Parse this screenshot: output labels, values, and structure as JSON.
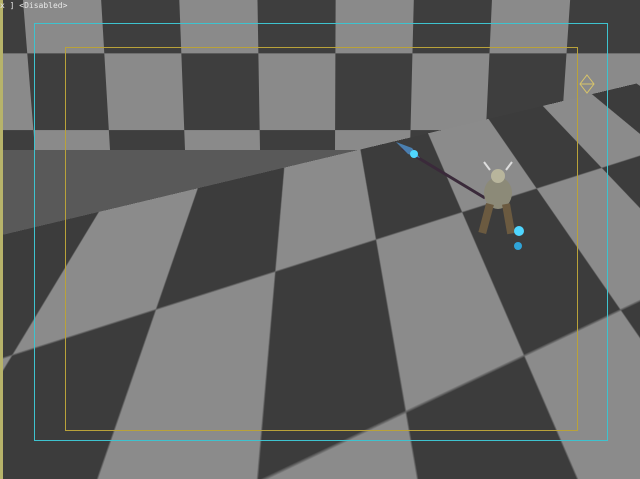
{
  "viewport": {
    "label": "x ] <Disabled>",
    "safe_frame_color": "#3ec3cf",
    "action_frame_color": "#b9a23a",
    "checker_light": "#8b8b8b",
    "checker_dark": "#3c3c3c"
  },
  "icons": {
    "gizmo": "light-target-icon",
    "character": "warrior-model"
  }
}
